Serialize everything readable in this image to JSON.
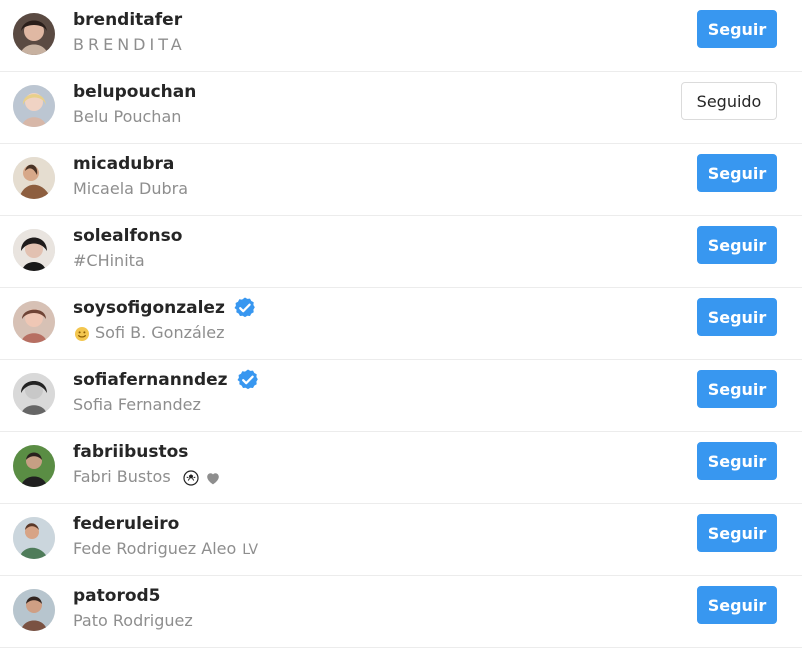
{
  "accounts": [
    {
      "username": "brenditafer",
      "full_name": "BRENDITA",
      "button_label": "Seguir",
      "verified": false
    },
    {
      "username": "belupouchan",
      "full_name": "Belu Pouchan",
      "button_label": "Seguido",
      "verified": false
    },
    {
      "username": "micadubra",
      "full_name": "Micaela Dubra",
      "button_label": "Seguir",
      "verified": false
    },
    {
      "username": "solealfonso",
      "full_name": "#CHinita",
      "button_label": "Seguir",
      "verified": false
    },
    {
      "username": "soysofigonzalez",
      "full_name": "Sofi B. González",
      "button_label": "Seguir",
      "verified": true
    },
    {
      "username": "sofiafernanndez",
      "full_name": "Sofia Fernandez",
      "button_label": "Seguir",
      "verified": true
    },
    {
      "username": "fabriibustos",
      "full_name": "Fabri Bustos",
      "button_label": "Seguir",
      "verified": false
    },
    {
      "username": "federuleiro",
      "full_name": "Fede Rodriguez Aleo",
      "button_label": "Seguir",
      "verified": false,
      "suffix_mark": "LV"
    },
    {
      "username": "patorod5",
      "full_name": "Pato Rodriguez",
      "button_label": "Seguir",
      "verified": false
    }
  ],
  "colors": {
    "follow_button": "#3897f0",
    "following_button_border": "#dbdbdb",
    "secondary_text": "#8e8e8e",
    "primary_text": "#262626",
    "divider": "#ececec",
    "verified_badge": "#3897f0"
  },
  "icons": {
    "verified": "verified-badge-icon",
    "avatar": "avatar",
    "prefix_emoji": "smiling-face-icon",
    "suffix_ball": "soccer-ball-icon",
    "suffix_heart": "heart-icon"
  }
}
